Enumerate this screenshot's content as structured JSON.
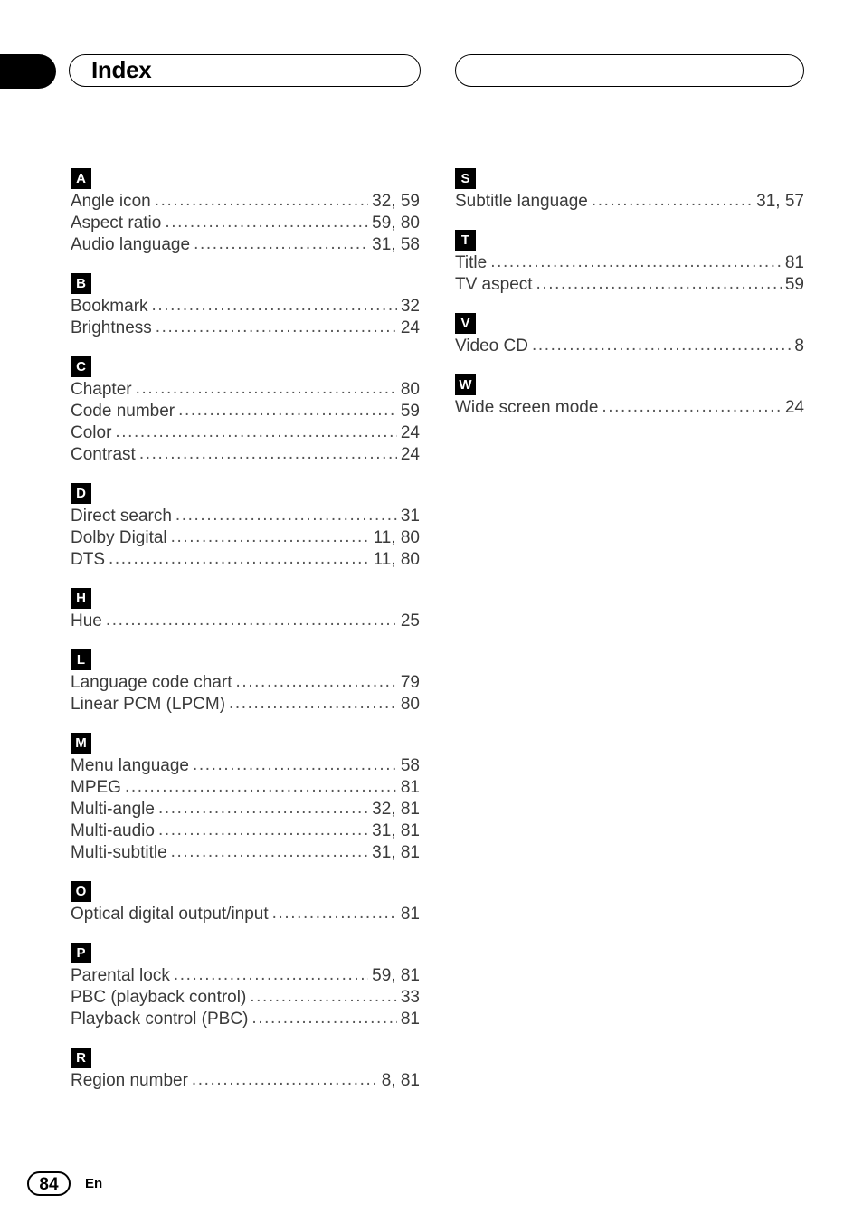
{
  "header": {
    "tab_icon": "black-tab-marker",
    "title": "Index",
    "right_box_title": ""
  },
  "footer": {
    "page_number": "84",
    "language": "En"
  },
  "columns": [
    {
      "name": "left-column",
      "sections": [
        {
          "letter": "A",
          "entries": [
            {
              "label": "Angle icon",
              "pages": "32, 59"
            },
            {
              "label": "Aspect ratio",
              "pages": "59, 80"
            },
            {
              "label": "Audio language",
              "pages": "31, 58"
            }
          ]
        },
        {
          "letter": "B",
          "entries": [
            {
              "label": "Bookmark",
              "pages": "32"
            },
            {
              "label": "Brightness",
              "pages": "24"
            }
          ]
        },
        {
          "letter": "C",
          "entries": [
            {
              "label": "Chapter",
              "pages": "80"
            },
            {
              "label": "Code number",
              "pages": "59"
            },
            {
              "label": "Color",
              "pages": "24"
            },
            {
              "label": "Contrast",
              "pages": "24"
            }
          ]
        },
        {
          "letter": "D",
          "entries": [
            {
              "label": "Direct search",
              "pages": "31"
            },
            {
              "label": "Dolby Digital",
              "pages": "11, 80"
            },
            {
              "label": "DTS",
              "pages": "11, 80"
            }
          ]
        },
        {
          "letter": "H",
          "entries": [
            {
              "label": "Hue",
              "pages": "25"
            }
          ]
        },
        {
          "letter": "L",
          "entries": [
            {
              "label": "Language code chart",
              "pages": "79"
            },
            {
              "label": "Linear PCM (LPCM)",
              "pages": "80"
            }
          ]
        },
        {
          "letter": "M",
          "entries": [
            {
              "label": "Menu language",
              "pages": "58"
            },
            {
              "label": "MPEG",
              "pages": "81"
            },
            {
              "label": "Multi-angle",
              "pages": "32, 81"
            },
            {
              "label": "Multi-audio",
              "pages": "31, 81"
            },
            {
              "label": "Multi-subtitle",
              "pages": "31, 81"
            }
          ]
        },
        {
          "letter": "O",
          "entries": [
            {
              "label": "Optical digital output/input",
              "pages": "81"
            }
          ]
        },
        {
          "letter": "P",
          "entries": [
            {
              "label": "Parental lock",
              "pages": "59, 81"
            },
            {
              "label": "PBC (playback control)",
              "pages": "33"
            },
            {
              "label": "Playback control (PBC)",
              "pages": "81"
            }
          ]
        },
        {
          "letter": "R",
          "entries": [
            {
              "label": "Region number",
              "pages": "8, 81"
            }
          ]
        }
      ]
    },
    {
      "name": "right-column",
      "sections": [
        {
          "letter": "S",
          "entries": [
            {
              "label": "Subtitle language",
              "pages": "31, 57"
            }
          ]
        },
        {
          "letter": "T",
          "entries": [
            {
              "label": "Title",
              "pages": "81"
            },
            {
              "label": "TV aspect",
              "pages": "59"
            }
          ]
        },
        {
          "letter": "V",
          "entries": [
            {
              "label": "Video CD",
              "pages": "8"
            }
          ]
        },
        {
          "letter": "W",
          "entries": [
            {
              "label": "Wide screen mode",
              "pages": "24"
            }
          ]
        }
      ]
    }
  ]
}
